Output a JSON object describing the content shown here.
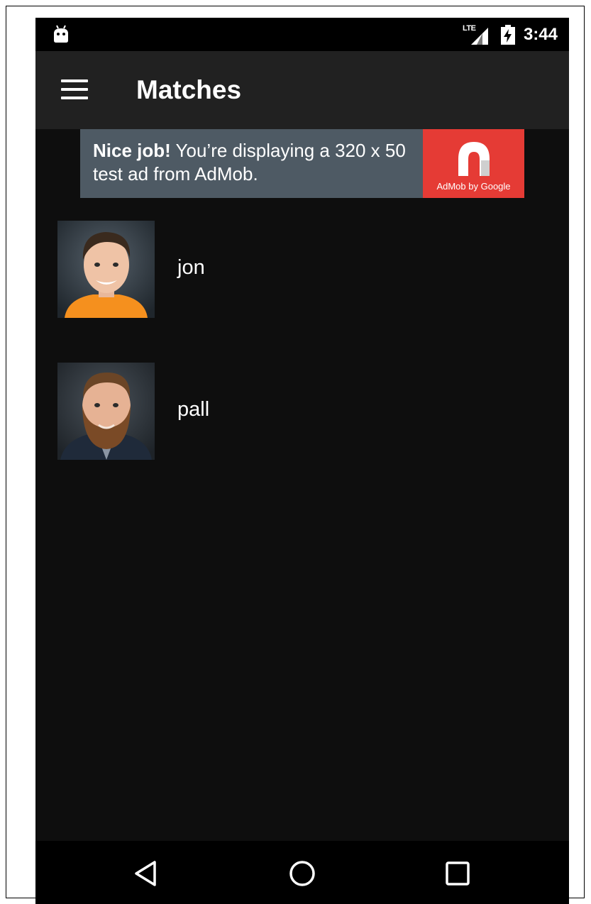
{
  "status_bar": {
    "network_label": "LTE",
    "time": "3:44",
    "icons": [
      "android-notification-icon",
      "signal-icon",
      "battery-charging-icon"
    ]
  },
  "app_bar": {
    "title": "Matches",
    "menu_icon": "hamburger-menu-icon"
  },
  "ad": {
    "headline_bold": "Nice job!",
    "headline_rest": " You’re displaying a 320 x 50 test ad from AdMob.",
    "brand_text": "AdMob by Google",
    "brand_color": "#e53b35",
    "banner_color": "#4e5a64"
  },
  "matches": [
    {
      "name": "jon",
      "shirt_color": "#f5901e"
    },
    {
      "name": "pall",
      "shirt_color": "#1f2a3a"
    }
  ],
  "nav_bar": {
    "icons": [
      "back-icon",
      "home-icon",
      "recents-icon"
    ]
  },
  "colors": {
    "background": "#0e0e0e",
    "app_bar": "#212121",
    "status_bar": "#000000"
  }
}
